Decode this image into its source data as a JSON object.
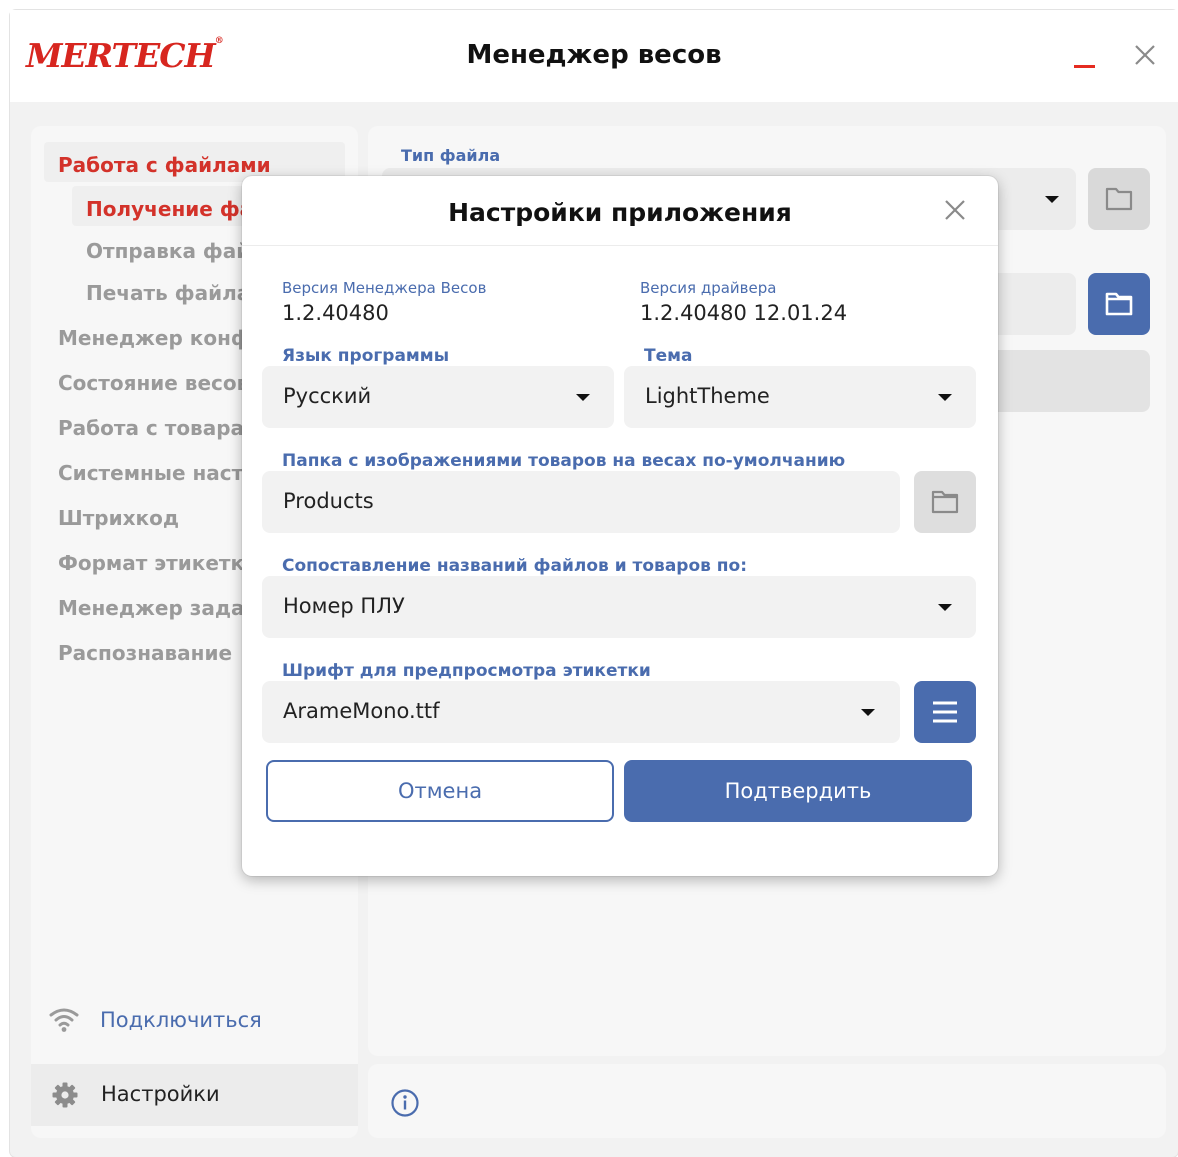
{
  "app": {
    "logo_text": "MERTECH",
    "logo_mark": "®",
    "title": "Менеджер весов",
    "brand_color": "#d7261f",
    "accent_color": "#4a6cae"
  },
  "sidebar": {
    "group_files": "Работа с файлами",
    "sub_receive": "Получение фай",
    "sub_send": "Отправка файл",
    "sub_print": "Печать файла",
    "items": [
      "Менеджер конфи",
      "Состояние весов",
      "Работа с товарам",
      "Системные настр",
      "Штрихкод",
      "Формат этикетки",
      "Менеджер задач",
      "Распознавание"
    ],
    "connect_label": "Подключиться",
    "connect_icon": "wifi-icon",
    "settings_label": "Настройки",
    "settings_icon": "gear-icon"
  },
  "background": {
    "file_type_label": "Тип файла",
    "folder_icon": "folder-icon"
  },
  "status": {
    "info_icon": "info-icon"
  },
  "dialog": {
    "title": "Настройки приложения",
    "close_icon": "close-icon",
    "manager_version_label": "Версия Менеджера Весов",
    "manager_version": "1.2.40480",
    "driver_version_label": "Версия драйвера",
    "driver_version": "1.2.40480 12.01.24",
    "language_label": "Язык программы",
    "language_value": "Русский",
    "theme_label": "Тема",
    "theme_value": "LightTheme",
    "images_folder_label": "Папка с изображениями товаров на весах по-умолчанию",
    "images_folder_value": "Products",
    "mapping_label": "Сопоставление названий файлов и товаров по:",
    "mapping_value": "Номер ПЛУ",
    "font_label": "Шрифт для предпросмотра этикетки",
    "font_value": "ArameMono.ttf",
    "cancel_label": "Отмена",
    "confirm_label": "Подтвердить"
  }
}
